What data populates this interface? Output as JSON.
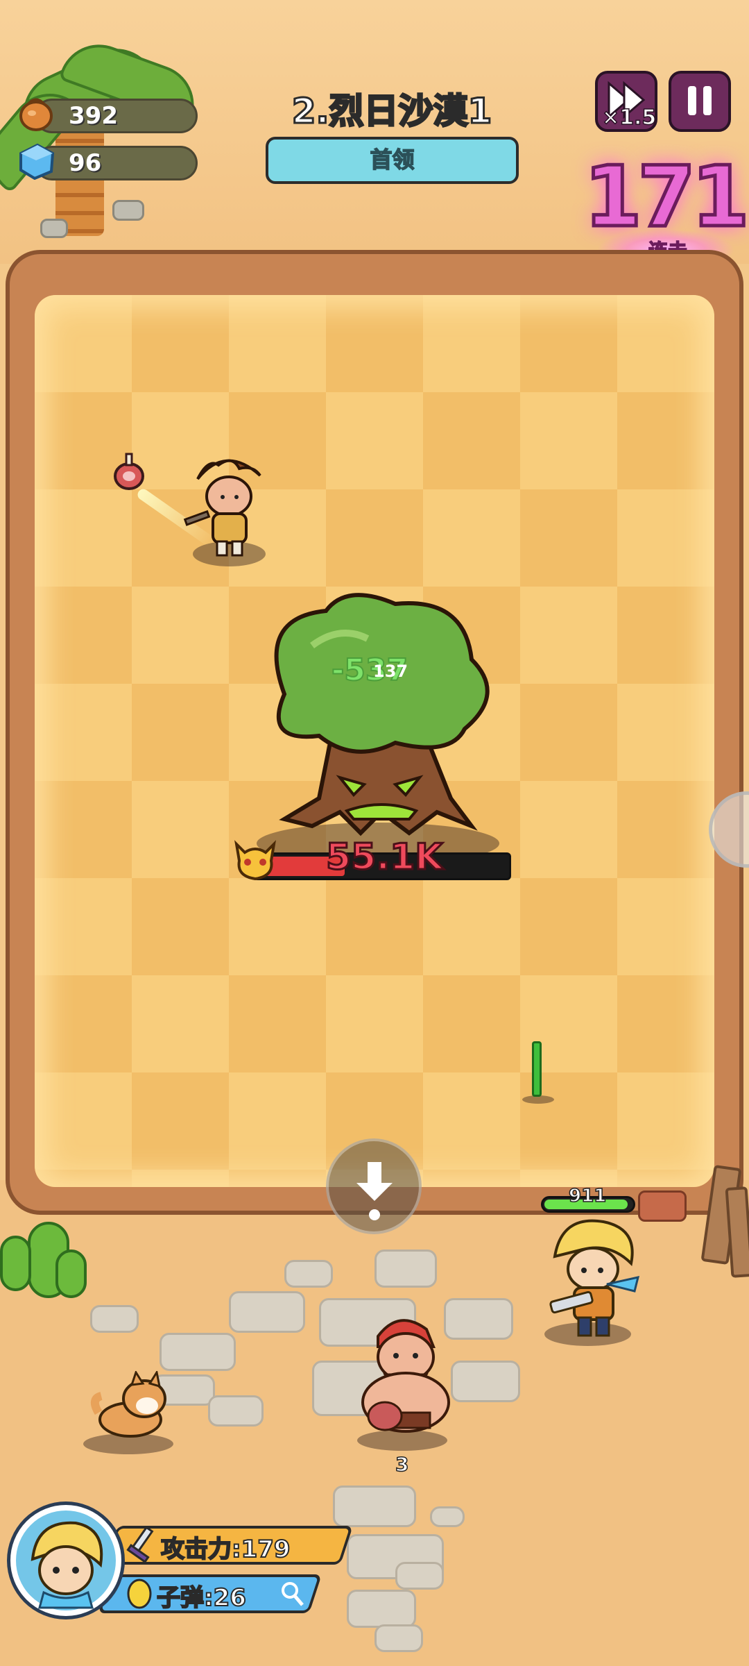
{
  "resources": {
    "food": "392",
    "gems": "96"
  },
  "level": {
    "title": "2.烈日沙漠1",
    "stage_label": "首领"
  },
  "controls": {
    "speed_label": "×1.5",
    "pause_icon": "pause-icon",
    "speed_icon": "fast-forward-icon"
  },
  "combo": {
    "count": "171",
    "label": "连击"
  },
  "battle": {
    "damage_popup": "-537",
    "damage_popup_small": "137",
    "boss_hp": "55.1K",
    "boss_hp_fraction": 0.35,
    "hero_hp": "911",
    "hero_hp_fraction": 0.95,
    "ally_count": "3"
  },
  "hud": {
    "attack_label": "攻击力:179",
    "ammo_label": "子弹:26"
  },
  "colors": {
    "sand": "#f3c88a",
    "board_light": "#f8cd7c",
    "board_dark": "#f2be68",
    "boss_hp": "#e23b3b",
    "hero_hp": "#6be34c",
    "combo": "#e86ad4",
    "attack_bar": "#f5b542",
    "ammo_bar": "#5bb7ee"
  }
}
